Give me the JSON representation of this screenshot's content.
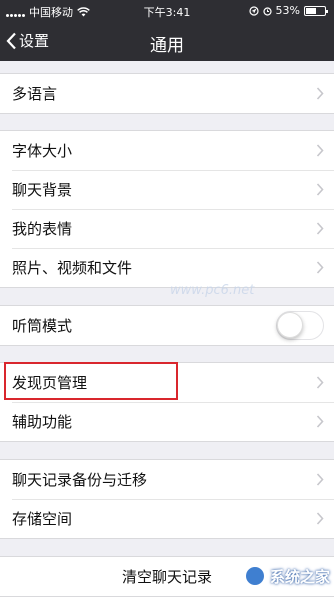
{
  "status_bar": {
    "carrier": "中国移动",
    "time": "下午3:41",
    "battery_percent": "53%",
    "battery_level": 0.53
  },
  "nav": {
    "back_label": "设置",
    "title": "通用"
  },
  "groups": [
    {
      "rows": [
        {
          "label": "多语言"
        }
      ]
    },
    {
      "rows": [
        {
          "label": "字体大小"
        },
        {
          "label": "聊天背景"
        },
        {
          "label": "我的表情"
        },
        {
          "label": "照片、视频和文件"
        }
      ]
    },
    {
      "rows": [
        {
          "label": "听筒模式",
          "toggle": false
        }
      ]
    },
    {
      "rows": [
        {
          "label": "发现页管理"
        },
        {
          "label": "辅助功能"
        }
      ]
    },
    {
      "rows": [
        {
          "label": "聊天记录备份与迁移"
        },
        {
          "label": "存储空间"
        }
      ]
    }
  ],
  "clear_button": "清空聊天记录",
  "watermarks": {
    "site": "www.pc6.net",
    "brand": "系统之家"
  },
  "colors": {
    "nav_bg": "#2e2e33",
    "page_bg": "#efeff4",
    "highlight": "#d9262d"
  }
}
